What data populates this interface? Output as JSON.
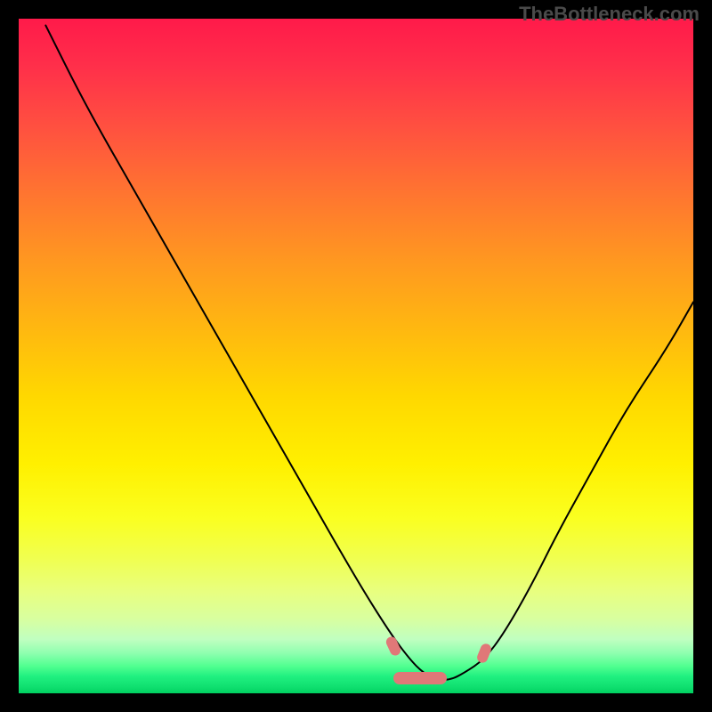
{
  "watermark": "TheBottleneck.com",
  "chart_data": {
    "type": "line",
    "title": "",
    "xlabel": "",
    "ylabel": "",
    "xlim": [
      0,
      100
    ],
    "ylim": [
      0,
      100
    ],
    "series": [
      {
        "name": "curve",
        "x": [
          4,
          10,
          18,
          26,
          34,
          42,
          50,
          55,
          58,
          60,
          62,
          64,
          66,
          69,
          72,
          76,
          80,
          85,
          90,
          96,
          100
        ],
        "y": [
          99,
          87,
          73,
          59,
          45,
          31,
          17,
          9,
          5,
          3,
          2,
          2,
          3,
          5,
          9,
          16,
          24,
          33,
          42,
          51,
          58
        ]
      }
    ],
    "highlight_range_x": [
      55,
      70
    ],
    "background_gradient": {
      "type": "vertical",
      "stops": [
        {
          "pos": 0,
          "color": "#ff1a4a"
        },
        {
          "pos": 50,
          "color": "#ffd800"
        },
        {
          "pos": 100,
          "color": "#00d060"
        }
      ]
    }
  }
}
